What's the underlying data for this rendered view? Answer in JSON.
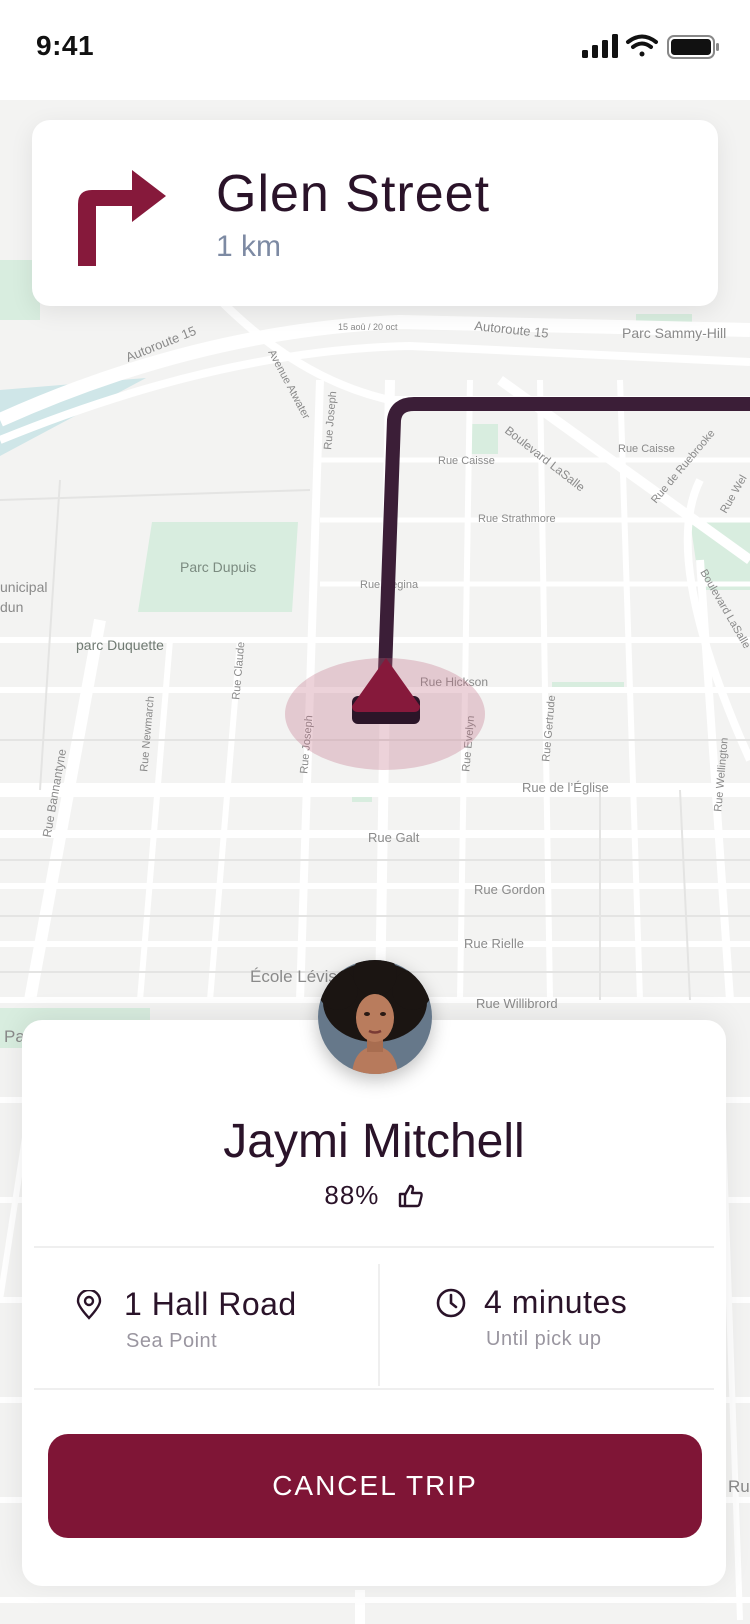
{
  "status_bar": {
    "time": "9:41"
  },
  "navigation": {
    "street": "Glen Street",
    "distance": "1 km",
    "turn_icon": "turn-right-arrow"
  },
  "map": {
    "labels": {
      "autoroute_left": "Autoroute 15",
      "autoroute_right": "Autoroute 15",
      "avenue_atwater": "Avenue Atwater",
      "parc_sammy_hill": "Parc Sammy-Hill",
      "rue_joseph_top": "Rue Joseph",
      "rue_caisse": "Rue Caisse",
      "rue_caisse_right": "Rue Caisse",
      "boulevard_lasalle": "Boulevard LaSalle",
      "rue_de_ruebrooke": "Rue de Ruebrooke",
      "rue_strathmore": "Rue Strathmore",
      "parc_dupuis": "Parc Dupuis",
      "municipal": "unicipal",
      "dun": "dun",
      "rue_regina": "Rue Regina",
      "parc_duquette": "parc Duquette",
      "rue_claude": "Rue Claude",
      "rue_hickson": "Rue Hickson",
      "rue_newmarch": "Rue Newmarch",
      "rue_joseph": "Rue Joseph",
      "rue_evelyn": "Rue Evelyn",
      "rue_gertrude": "Rue Gertrude",
      "rue_wellington": "Rue Wellington",
      "rue_bannantyne": "Rue Bannantyne",
      "rue_de_leglise": "Rue de l’Église",
      "rue_galt": "Rue Galt",
      "rue_gordon": "Rue Gordon",
      "rue_rielle": "Rue Rielle",
      "ecole": "École Lévis",
      "rue_willibrord": "Rue Willibrord",
      "pa": "Pa",
      "ru": "Ru",
      "boulevard_right": "Boulevard LaSalle",
      "speed_sign": "15 aoû / 20 oct",
      "rue_wel_top": "Rue Wel"
    }
  },
  "driver": {
    "name": "Jaymi Mitchell",
    "rating": "88%",
    "rating_icon": "thumbs-up"
  },
  "pickup": {
    "address": "1 Hall Road",
    "area": "Sea Point",
    "icon": "location-pin"
  },
  "eta": {
    "time": "4 minutes",
    "label": "Until pick up",
    "icon": "clock"
  },
  "actions": {
    "cancel": "CANCEL TRIP"
  },
  "colors": {
    "brand": "#7f1536",
    "route": "#3b1e37",
    "text": "#2a1329",
    "muted": "#9a96a0"
  }
}
